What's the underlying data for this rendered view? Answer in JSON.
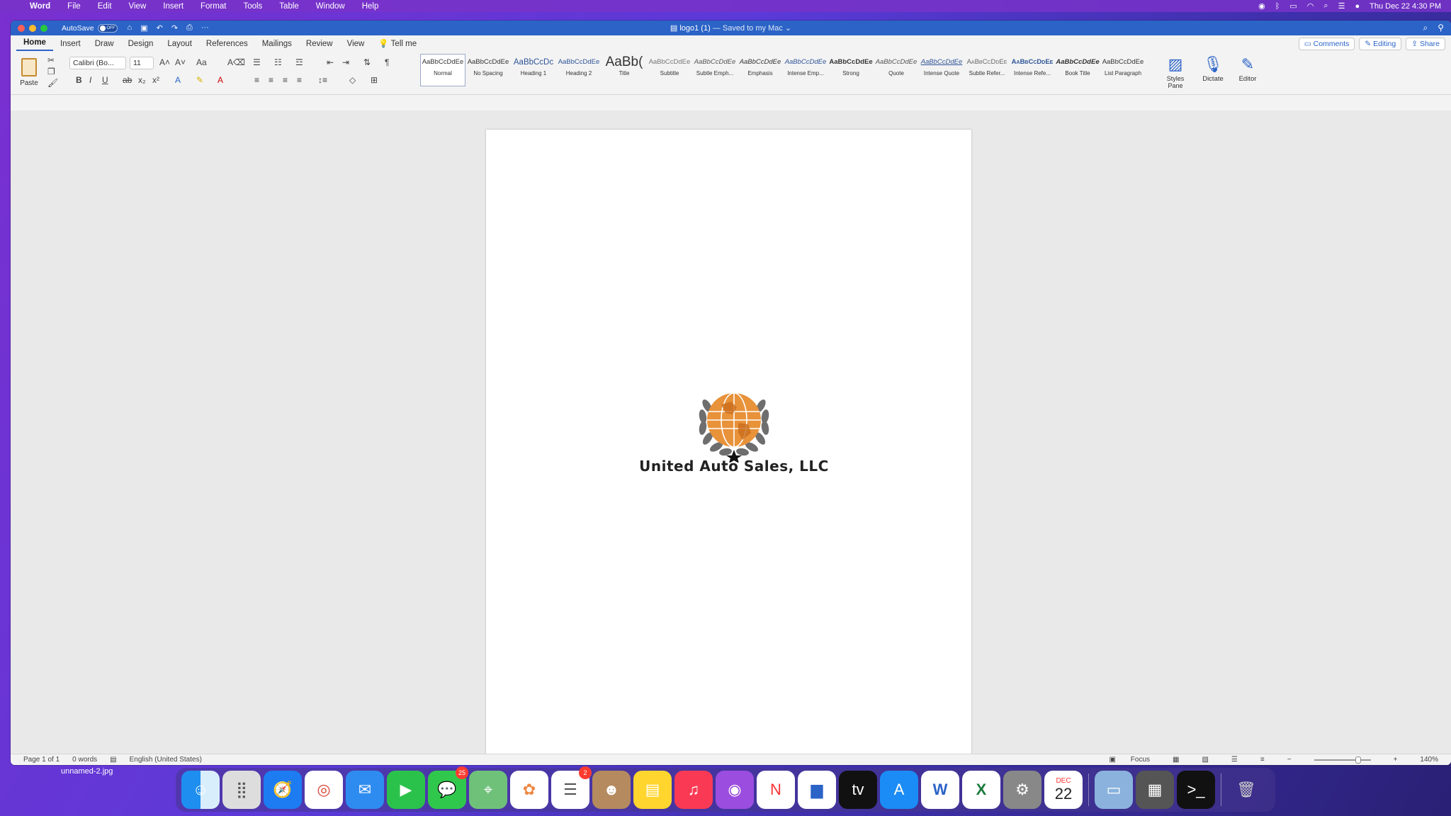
{
  "menubar": {
    "app_name": "Word",
    "items": [
      "File",
      "Edit",
      "View",
      "Insert",
      "Format",
      "Tools",
      "Table",
      "Window",
      "Help"
    ],
    "clock": "Thu Dec 22  4:30 PM"
  },
  "titlebar": {
    "autosave_label": "AutoSave",
    "autosave_state": "OFF",
    "doc_name": "logo1 (1)",
    "doc_status": "— Saved to my Mac"
  },
  "ribbon_tabs": {
    "tabs": [
      "Home",
      "Insert",
      "Draw",
      "Design",
      "Layout",
      "References",
      "Mailings",
      "Review",
      "View"
    ],
    "tell_me": "Tell me",
    "comments": "Comments",
    "editing": "Editing",
    "share": "Share"
  },
  "ribbon": {
    "paste_label": "Paste",
    "font_name": "Calibri (Bo...",
    "font_size": "11",
    "styles": [
      {
        "preview": "AaBbCcDdEe",
        "label": "Normal"
      },
      {
        "preview": "AaBbCcDdEe",
        "label": "No Spacing"
      },
      {
        "preview": "AaBbCcDc",
        "label": "Heading 1"
      },
      {
        "preview": "AaBbCcDdEe",
        "label": "Heading 2"
      },
      {
        "preview": "AaBb(",
        "label": "Title"
      },
      {
        "preview": "AaBbCcDdEe",
        "label": "Subtitle"
      },
      {
        "preview": "AaBbCcDdEe",
        "label": "Subtle Emph..."
      },
      {
        "preview": "AaBbCcDdEe",
        "label": "Emphasis"
      },
      {
        "preview": "AaBbCcDdEe",
        "label": "Intense Emp..."
      },
      {
        "preview": "AaBbCcDdEe",
        "label": "Strong"
      },
      {
        "preview": "AaBbCcDdEe",
        "label": "Quote"
      },
      {
        "preview": "AaBbCcDdEe",
        "label": "Intense Quote"
      },
      {
        "preview": "AaBbCcDdEe",
        "label": "Subtle Refer..."
      },
      {
        "preview": "AaBbCcDdEe",
        "label": "Intense Refe..."
      },
      {
        "preview": "AaBbCcDdEe",
        "label": "Book Title"
      },
      {
        "preview": "AaBbCcDdEe",
        "label": "List Paragraph"
      }
    ],
    "styles_pane_label_1": "Styles",
    "styles_pane_label_2": "Pane",
    "dictate_label": "Dictate",
    "editor_label": "Editor"
  },
  "document": {
    "logo_text": "United Auto Sales, LLC"
  },
  "statusbar": {
    "page": "Page 1 of 1",
    "words": "0 words",
    "language": "English (United States)",
    "focus": "Focus",
    "zoom": "140%"
  },
  "tooltip": "unnamed-2.jpg",
  "dock": {
    "messages_badge": "25",
    "reminders_badge": "2",
    "calendar_month": "DEC",
    "calendar_day": "22"
  }
}
